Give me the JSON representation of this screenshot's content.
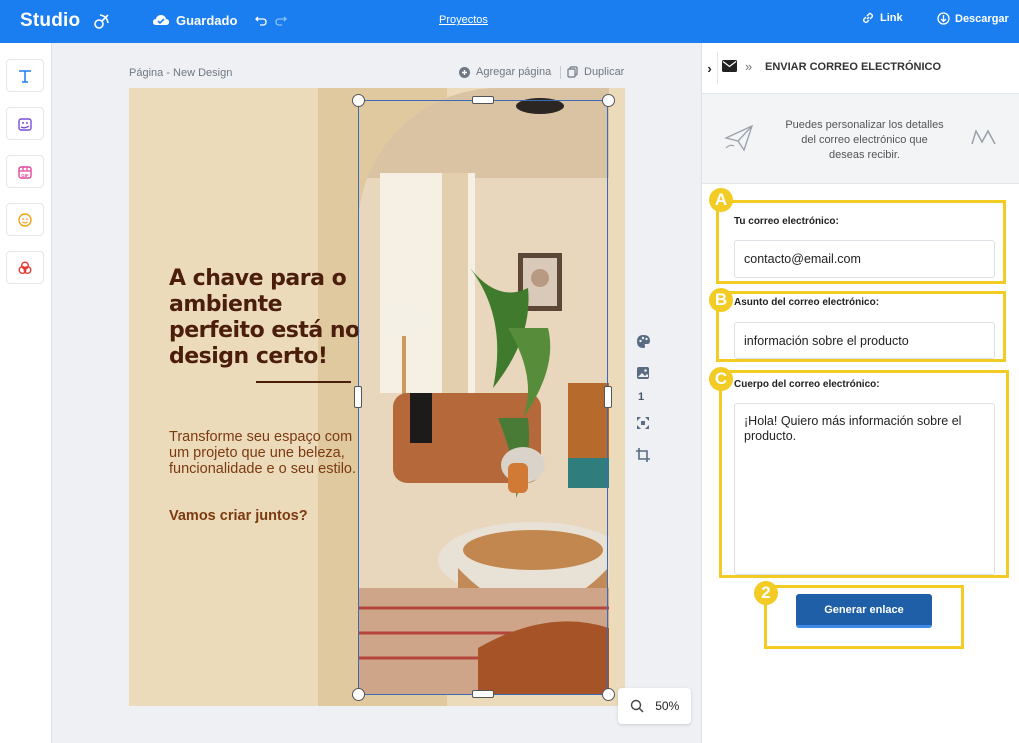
{
  "topbar": {
    "brand": "Studio",
    "saved": "Guardado",
    "projects": "Proyectos",
    "link": "Link",
    "download": "Descargar",
    "bg_color": "#1a7ef0"
  },
  "left_tools": [
    {
      "name": "text-tool",
      "icon": "text-icon"
    },
    {
      "name": "image-tool",
      "icon": "image-sparkle-icon"
    },
    {
      "name": "gif-tool",
      "icon": "gif-icon"
    },
    {
      "name": "emoji-tool",
      "icon": "emoji-icon"
    },
    {
      "name": "shapes-tool",
      "icon": "shapes-icon"
    }
  ],
  "canvas": {
    "page_label": "Página - New Design",
    "add_page": "Agregar página",
    "duplicate": "Duplicar",
    "page_number": "1",
    "zoom": "50%"
  },
  "design": {
    "headline": "A chave para o ambiente perfeito está no design certo!",
    "body": "Transforme seu espaço com um projeto que une beleza, funcionalidade e o seu estilo.",
    "cta": "Vamos criar juntos?",
    "bg_color": "#ecdbbb",
    "text_color": "#4a1e0a"
  },
  "panel": {
    "title": "ENVIAR CORREO ELECTRÓNICO",
    "info": "Puedes personalizar los detalles del correo electrónico que deseas recibir.",
    "email_label": "Tu correo electrónico:",
    "email_value": "contacto@email.com",
    "subject_label": "Asunto del correo electrónico:",
    "subject_value": "información sobre el producto",
    "body_label": "Cuerpo del correo electrónico:",
    "body_value": "¡Hola! Quiero más información sobre el producto.",
    "generate_button": "Generar enlace"
  },
  "annotations": {
    "badge_a": "A",
    "badge_b": "B",
    "badge_c": "C",
    "badge_2": "2",
    "color": "#f2cc25"
  }
}
